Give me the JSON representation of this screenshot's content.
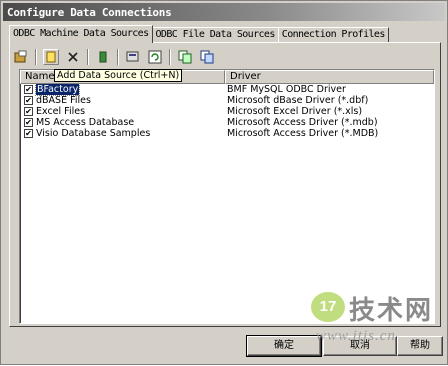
{
  "window": {
    "title": "Configure Data Connections"
  },
  "tabs": [
    {
      "label": "ODBC Machine Data Sources",
      "active": true
    },
    {
      "label": "ODBC File Data Sources",
      "active": false
    },
    {
      "label": "Connection Profiles",
      "active": false
    }
  ],
  "toolbar": {
    "icons": [
      "new-source-icon",
      "add-data-source-icon",
      "delete-icon",
      "configure-icon",
      "refresh-icon",
      "import-icon",
      "copy-icon",
      "paste-icon"
    ]
  },
  "tooltip": {
    "text": "Add Data Source (Ctrl+N)"
  },
  "list": {
    "columns": [
      "Name",
      "Driver"
    ],
    "rows": [
      {
        "name": "BFactory",
        "driver": "BMF MySQL ODBC Driver",
        "checked": true,
        "selected": true
      },
      {
        "name": "dBASE Files",
        "driver": "Microsoft dBase Driver (*.dbf)",
        "checked": true,
        "selected": false
      },
      {
        "name": "Excel Files",
        "driver": "Microsoft Excel Driver (*.xls)",
        "checked": true,
        "selected": false
      },
      {
        "name": "MS Access Database",
        "driver": "Microsoft Access Driver (*.mdb)",
        "checked": true,
        "selected": false
      },
      {
        "name": "Visio Database Samples",
        "driver": "Microsoft Access Driver (*.MDB)",
        "checked": true,
        "selected": false
      }
    ]
  },
  "buttons": {
    "ok": "确定",
    "cancel": "取消",
    "help": "帮助"
  },
  "watermark": {
    "logo": "17",
    "text": "技术网",
    "url": "www.itjs.cn"
  },
  "colors": {
    "selection": "#0a246a",
    "dialog": "#d4d0c8",
    "tooltip_bg": "#ffffe1"
  }
}
